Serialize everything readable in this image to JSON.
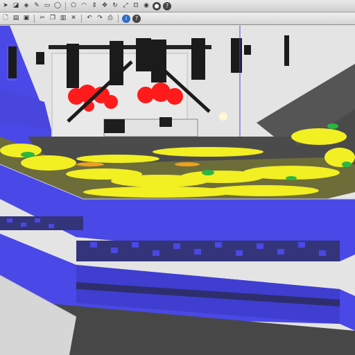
{
  "app": {
    "name": "3D modeling viewport"
  },
  "toolbar_top": {
    "icons": [
      "select-arrow-icon",
      "eraser-icon",
      "paint-bucket-icon",
      "pencil-icon",
      "rectangle-icon",
      "circle-icon",
      "polygon-icon",
      "arc-icon",
      "push-pull-icon",
      "move-icon",
      "rotate-icon",
      "scale-icon",
      "offset-icon",
      "camera-icon",
      "orbit-icon",
      "help-icon"
    ]
  },
  "toolbar_second": {
    "icons": [
      "new-file-icon",
      "open-file-icon",
      "save-icon",
      "cut-icon",
      "copy-icon",
      "paste-icon",
      "erase-icon",
      "undo-icon",
      "redo-icon",
      "print-icon",
      "info-icon",
      "help-icon"
    ]
  },
  "colors": {
    "wall_blue": "#4a48e6",
    "wall_dark": "#34347a",
    "floor_grey": "#4b4b4b",
    "seat_yellow": "#f2ef22",
    "seat_green": "#2bb641",
    "seat_orange": "#f0a01c",
    "stage_red": "#ff1b1b",
    "sky_grey": "#e6e6e6",
    "grid_line": "#bfbfbf"
  }
}
